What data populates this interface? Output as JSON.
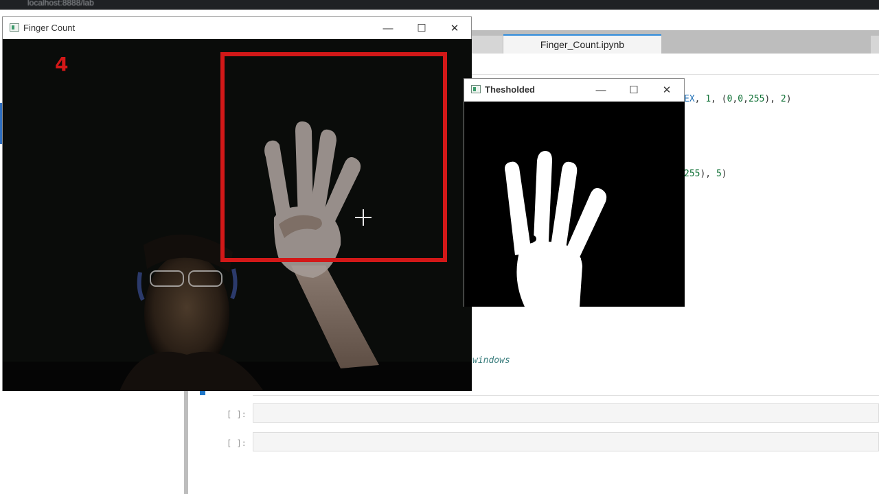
{
  "browser": {
    "url_text": "localhost:8888/lab"
  },
  "jupyter": {
    "active_tab_label": "Finger_Count.ipynb",
    "code_lines": {
      "line1": "EX, 1, (0,0,255), 2)",
      "line2": "255), 5)",
      "line3": "windows"
    },
    "empty_prompts": [
      "[ ]:",
      "[ ]:"
    ]
  },
  "finger_window": {
    "title": "Finger Count",
    "count_text": "4",
    "roi_color": "#d21818",
    "controls": {
      "minimize": "—",
      "maximize": "☐",
      "close": "✕"
    }
  },
  "thresh_window": {
    "title": "Thesholded",
    "controls": {
      "minimize": "—",
      "maximize": "☐",
      "close": "✕"
    }
  }
}
